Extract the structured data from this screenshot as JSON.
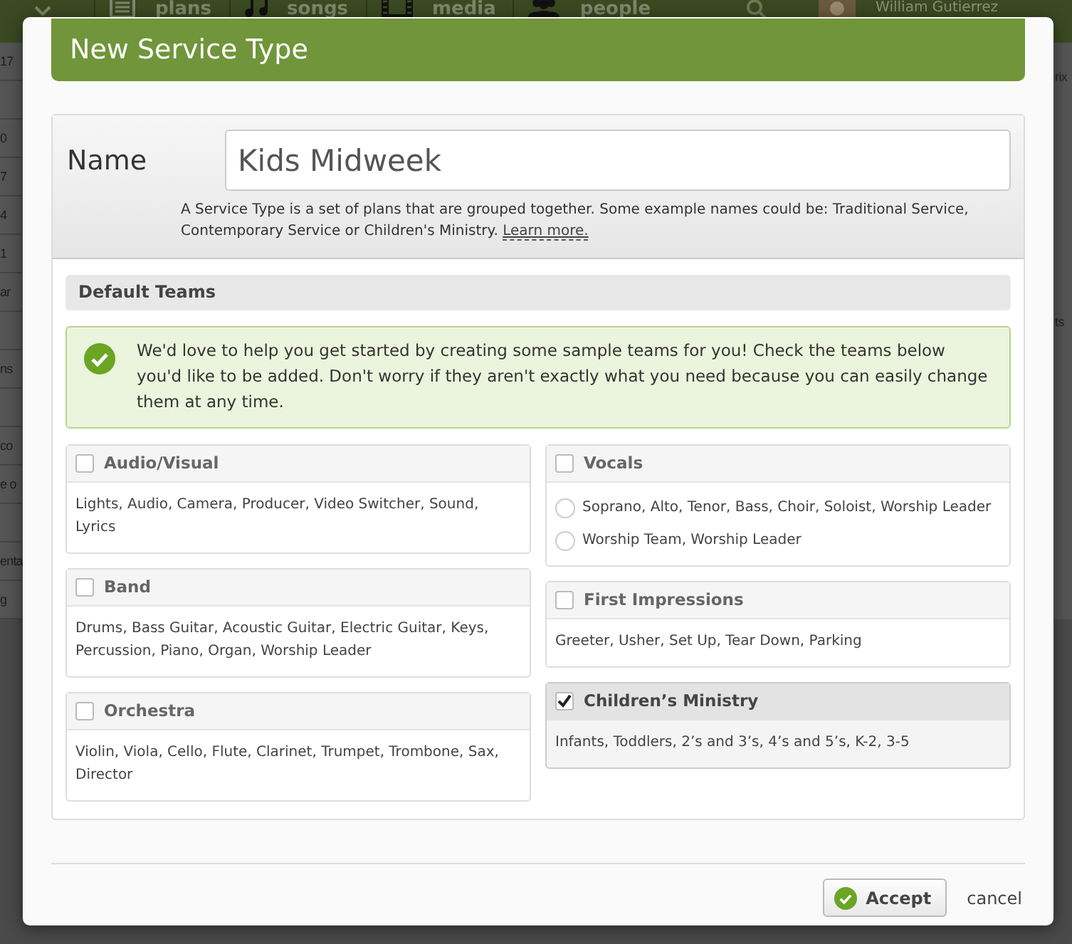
{
  "background": {
    "nav": [
      {
        "label": "plans"
      },
      {
        "label": "songs"
      },
      {
        "label": "media"
      },
      {
        "label": "people"
      }
    ],
    "user": "William Gutierrez",
    "left_fragments": [
      "17",
      "0",
      "7",
      "4",
      "1",
      "ar",
      "ns",
      "co",
      "e o",
      "enta",
      "g"
    ],
    "right_fragments": [
      "rix",
      "ts"
    ]
  },
  "dialog": {
    "title": "New Service Type",
    "name_label": "Name",
    "name_value": "Kids Midweek",
    "help": "A Service Type is a set of plans that are grouped together. Some example names could be: Traditional Service, Contemporary Service or Children's Ministry.",
    "help_link": "Learn more.",
    "section_title": "Default Teams",
    "notice": "We'd love to help you get started by creating some sample teams for you! Check the teams below you'd like to be added. Don't worry if they aren't exactly what you need because you can easily change them at any time.",
    "team_columns": [
      [
        {
          "name": "Audio/Visual",
          "checked": false,
          "kind": "text",
          "roles": "Lights, Audio, Camera, Producer, Video Switcher, Sound, Lyrics"
        },
        {
          "name": "Band",
          "checked": false,
          "kind": "text",
          "roles": "Drums, Bass Guitar, Acoustic Guitar, Electric Guitar, Keys, Percussion, Piano, Organ, Worship Leader"
        },
        {
          "name": "Orchestra",
          "checked": false,
          "kind": "text",
          "roles": "Violin, Viola, Cello, Flute, Clarinet, Trumpet, Trombone, Sax, Director"
        }
      ],
      [
        {
          "name": "Vocals",
          "checked": false,
          "kind": "choice",
          "options": [
            {
              "label": "Soprano, Alto, Tenor, Bass, Choir, Soloist, Worship Leader",
              "selected": false
            },
            {
              "label": "Worship Team, Worship Leader",
              "selected": false
            }
          ]
        },
        {
          "name": "First Impressions",
          "checked": false,
          "kind": "text",
          "roles": "Greeter, Usher, Set Up, Tear Down, Parking"
        },
        {
          "name": "Children’s Ministry",
          "checked": true,
          "kind": "text",
          "roles": "Infants, Toddlers, 2’s and 3’s, 4’s and 5’s, K-2, 3-5"
        }
      ]
    ],
    "buttons": {
      "accept": "Accept",
      "cancel": "cancel"
    }
  }
}
